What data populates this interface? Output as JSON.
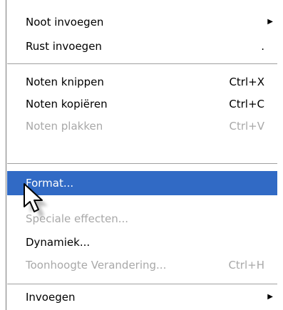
{
  "menu": {
    "items": [
      {
        "label": "Noot invoegen",
        "shortcut": "",
        "submenu": true,
        "disabled": false
      },
      {
        "label": "Rust invoegen",
        "shortcut": ".",
        "submenu": false,
        "disabled": false
      },
      {
        "label": "Noten knippen",
        "shortcut": "Ctrl+X",
        "submenu": false,
        "disabled": false
      },
      {
        "label": "Noten kopiëren",
        "shortcut": "Ctrl+C",
        "submenu": false,
        "disabled": false
      },
      {
        "label": "Noten plakken",
        "shortcut": "Ctrl+V",
        "submenu": false,
        "disabled": true
      },
      {
        "label": "Format...",
        "shortcut": "",
        "submenu": false,
        "disabled": false,
        "selected": true
      },
      {
        "label": "Speciale effecten...",
        "shortcut": "",
        "submenu": false,
        "disabled": true
      },
      {
        "label": "Dynamiek...",
        "shortcut": "",
        "submenu": false,
        "disabled": false
      },
      {
        "label": "Toonhoogte Verandering...",
        "shortcut": "Ctrl+H",
        "submenu": false,
        "disabled": true
      },
      {
        "label": "Invoegen",
        "shortcut": "",
        "submenu": true,
        "disabled": false
      }
    ],
    "submenu_arrow_icon": "triangle-right-icon",
    "cursor_icon": "mouse-pointer-icon"
  },
  "colors": {
    "selection": "#316ac5",
    "disabled_text": "#a8a8a8",
    "separator": "#a0a0a0"
  }
}
